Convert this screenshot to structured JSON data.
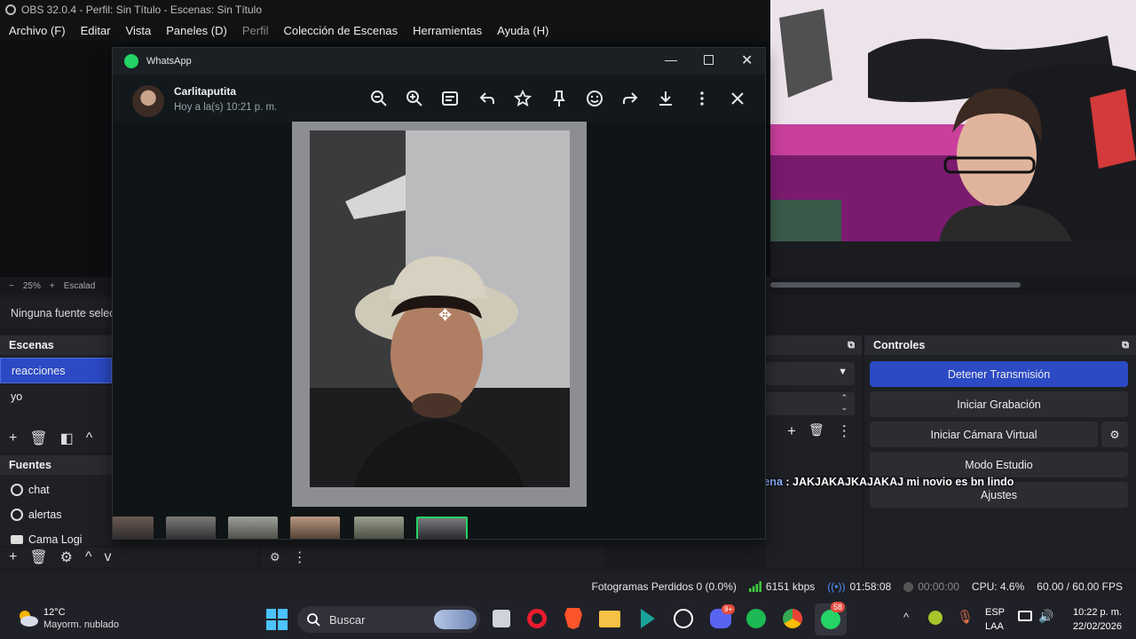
{
  "obs": {
    "title": "OBS 32.0.4 - Perfil: Sin Título - Escenas: Sin Título",
    "menu": [
      "Archivo (F)",
      "Editar",
      "Vista",
      "Paneles (D)",
      "Perfil",
      "Colección de Escenas",
      "Herramientas",
      "Ayuda (H)"
    ],
    "zoom": "25%",
    "scale_label": "Escalad",
    "no_source": "Ninguna fuente seleccionada",
    "scenes": {
      "title": "Escenas",
      "items": [
        "reacciones",
        "yo"
      ]
    },
    "sources": {
      "title": "Fuentes",
      "items": [
        "chat",
        "alertas",
        "Cama Logi"
      ]
    },
    "controls": {
      "title": "Controles",
      "stop_stream": "Detener Transmisión",
      "start_recording": "Iniciar Grabación",
      "start_virtual_cam": "Iniciar Cámara Virtual",
      "studio_mode": "Modo Estudio",
      "settings": "Ajustes"
    },
    "status": {
      "dropped_frames": "Fotogramas Perdidos 0 (0.0%)",
      "bitrate": "6151 kbps",
      "stream_time": "01:58:08",
      "record_time": "00:00:00",
      "cpu": "CPU: 4.6%",
      "fps": "60.00 / 60.00 FPS"
    }
  },
  "whatsapp": {
    "app_name": "WhatsApp",
    "contact_name": "Carlitaputita",
    "timestamp": "Hoy a la(s) 10:21 p. m.",
    "tools": [
      "zoom-out-icon",
      "zoom-in-icon",
      "caption-icon",
      "reply-icon",
      "star-icon",
      "pin-icon",
      "emoji-icon",
      "forward-icon",
      "download-icon",
      "more-icon",
      "close-icon"
    ]
  },
  "chat_overlay": {
    "user": "zarattemilena",
    "message": " : JAKJAKAJKAJAKAJ mi novio es bn lindo"
  },
  "taskbar": {
    "weather_temp": "12°C",
    "weather_desc": "Mayorm. nublado",
    "search_placeholder": "Buscar",
    "discord_badge": "9+",
    "whatsapp_badge": "58",
    "language": "ESP",
    "layout": "LAA",
    "time": "10:22 p. m.",
    "date": "22/02/2026"
  },
  "colors": {
    "obs_accent": "#2b4ac4",
    "whatsapp_green": "#25d366"
  }
}
